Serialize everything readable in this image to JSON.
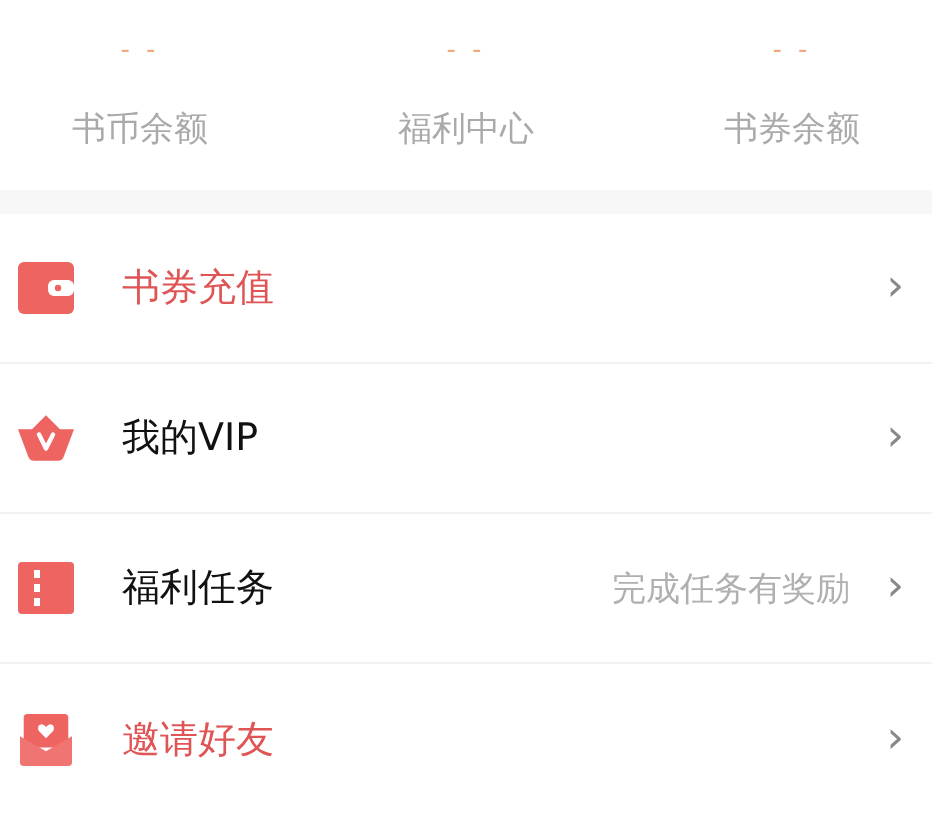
{
  "stats": [
    {
      "value": "- -",
      "label": "书币余额"
    },
    {
      "value": "- -",
      "label": "福利中心"
    },
    {
      "value": "- -",
      "label": "书券余额"
    }
  ],
  "menu": [
    {
      "label": "书券充值",
      "accent": true
    },
    {
      "label": "我的VIP",
      "accent": false
    },
    {
      "label": "福利任务",
      "accent": false,
      "hint": "完成任务有奖励"
    },
    {
      "label": "邀请好友",
      "accent": true
    }
  ],
  "chevron": "›"
}
